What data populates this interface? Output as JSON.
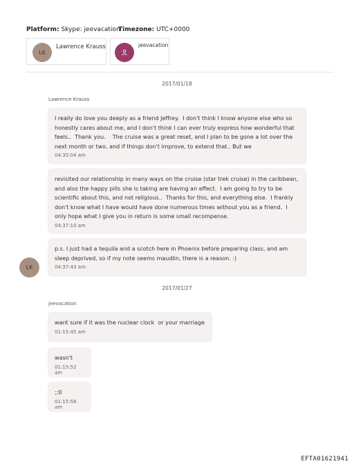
{
  "header": {
    "platform_label": "Platform:",
    "platform_value": "Skype: jeevacation",
    "timezone_label": "Timezone:",
    "timezone_value": "UTC+0000"
  },
  "participants": [
    {
      "initials": "LK",
      "name": "Lawrence Krauss",
      "avatar_color": "#a89080"
    },
    {
      "initials": "",
      "name": "jeevacation",
      "avatar_color": "#9b3a6a",
      "icon": "user-icon"
    }
  ],
  "groups": [
    {
      "date": "2017/01/18",
      "sender": "Lawrence Krauss",
      "avatar_initials": "LK",
      "messages": [
        {
          "text": "I really do love you deeply as a friend Jeffrey.  I don't think I know anyone else who so honestly cares about me, and I don't think I can ever truly express how wonderful that feels..  Thank you.    The cruise was a great reset, and I plan to be gone a lot over the next month or two, and if things don't improve, to extend that.. But we",
          "time": "04:35:04 am"
        },
        {
          "text": "revisited our relationship in many ways on the cruise (star trek cruise) in the caribbean, and also the happy pills she is taking are having an effect.  I am going to try to be scientific about this, and not religious..  Thanks for this, and everything else.  I frankly don't know what I have would have done numerous times without you as a friend.  I only hope what I give you in return is some small recompense.",
          "time": "04:37:10 am"
        },
        {
          "text": "p.s. I just had a tequila and a scotch here in Phoenix before preparing class, and am sleep deprived, so if my note seems maudlin, there is a reason. :)",
          "time": "04:37:43 am"
        }
      ]
    },
    {
      "date": "2017/01/27",
      "sender": "jeevacation",
      "messages": [
        {
          "text": "want sure if it was the nuclear clock  or your marriage",
          "time": "01:15:45 am"
        },
        {
          "text": "wasn't",
          "time": "01:15:52 am"
        },
        {
          "text": ";;0",
          "time": "01:15:58 am"
        }
      ]
    }
  ],
  "footer": {
    "doc_id": "EFTA01621941"
  }
}
